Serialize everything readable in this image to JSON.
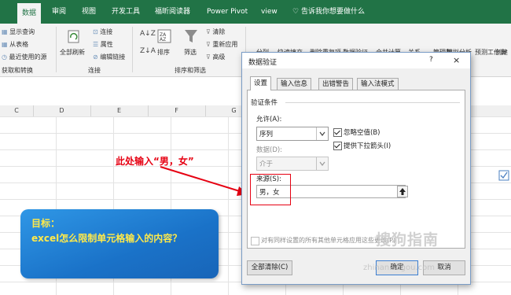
{
  "ribbon_tabs": [
    "数据",
    "审阅",
    "视图",
    "开发工具",
    "福昕阅读器",
    "Power Pivot",
    "view",
    "告诉我你想要做什么"
  ],
  "ribbon": {
    "get_transform": {
      "items": [
        "显示查询",
        "从表格",
        "最近使用的源"
      ],
      "label": "获取和转换"
    },
    "connections": {
      "refresh_all": "全部刷新",
      "items": [
        "连接",
        "属性",
        "编辑链接"
      ],
      "label": "连接"
    },
    "sort_filter": {
      "sort": "排序",
      "filter": "筛选",
      "items": [
        "清除",
        "重新应用",
        "高级"
      ],
      "label": "排序和筛选"
    },
    "data_tools": {
      "items": [
        "分列",
        "快速填充",
        "删除重复项",
        "数据验证",
        "合并计算",
        "关系",
        "管理数"
      ]
    },
    "forecast": {
      "items": [
        "模拟分析",
        "预测工作表"
      ]
    },
    "outline": {
      "items": [
        "创建"
      ]
    }
  },
  "columns": [
    "C",
    "D",
    "E",
    "F",
    "G"
  ],
  "annotation": "此处输入“男，女”",
  "goal": {
    "title": "目标：",
    "text": "excel怎么限制单元格输入的内容？"
  },
  "dialog": {
    "title": "数据验证",
    "help": "?",
    "close": "×",
    "tabs": [
      "设置",
      "输入信息",
      "出错警告",
      "输入法模式"
    ],
    "section": "验证条件",
    "allow_label": "允许(A):",
    "allow_value": "序列",
    "ignore_blank": "忽略空值(B)",
    "dropdown_arrow": "提供下拉箭头(I)",
    "data_label": "数据(D):",
    "data_value": "介于",
    "source_label": "来源(S):",
    "source_value": "男，女",
    "apply_all": "对有同样设置的所有其他单元格应用这些更改(P)",
    "clear_all": "全部清除(C)",
    "ok": "确定",
    "cancel": "取消"
  },
  "watermark": {
    "main": "搜狗指南",
    "url": "zhinan.sogou.com"
  }
}
